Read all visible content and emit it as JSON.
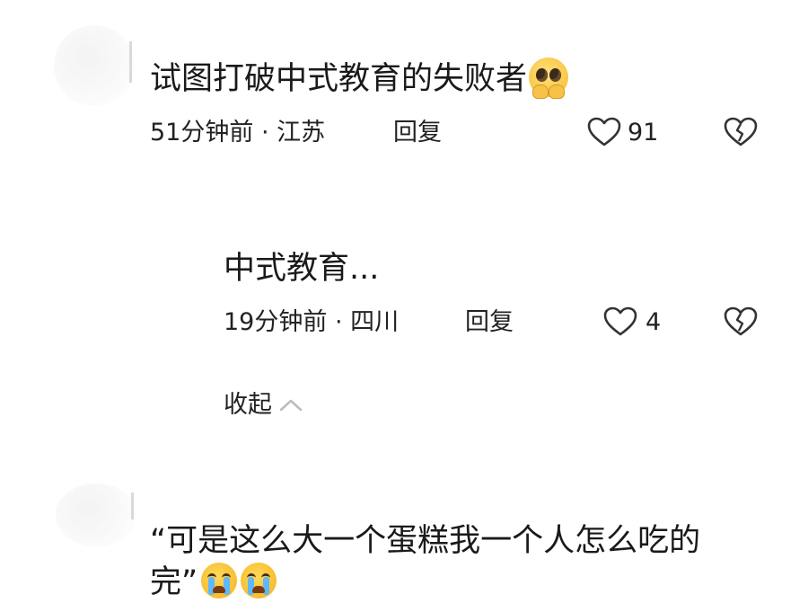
{
  "comments": [
    {
      "text": "试图打破中式教育的失败者",
      "emoji": "pleading-face",
      "time": "51分钟前",
      "separator": "·",
      "location": "江苏",
      "reply_label": "回复",
      "likes": "91",
      "replies": [
        {
          "text": "中式教育...",
          "time": "19分钟前",
          "separator": "·",
          "location": "四川",
          "reply_label": "回复",
          "likes": "4"
        }
      ],
      "collapse_label": "收起"
    },
    {
      "text_line1": "“可是这么大一个蛋糕我一个人怎么吃的",
      "text_line2": "完”",
      "emoji": "loudly-crying-face"
    }
  ],
  "icons": {
    "like": "heart-outline-icon",
    "dislike": "broken-heart-icon",
    "collapse": "chevron-up-icon"
  },
  "colors": {
    "text": "#1a1a1a",
    "icon_stroke": "#333333",
    "muted_icon": "#bdbdbd"
  }
}
